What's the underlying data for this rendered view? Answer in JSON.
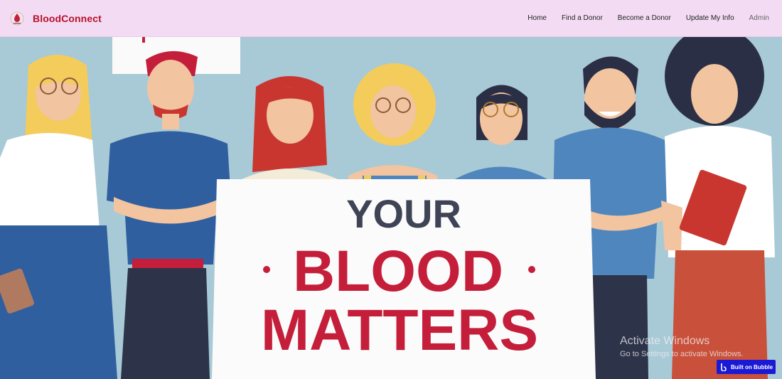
{
  "brand": {
    "name": "BloodConnect",
    "logo_icon": "blood-drop-logo-icon"
  },
  "nav": {
    "items": [
      {
        "label": "Home"
      },
      {
        "label": "Find a Donor"
      },
      {
        "label": "Become a Donor"
      },
      {
        "label": "Update My Info"
      },
      {
        "label": "Admin"
      }
    ]
  },
  "hero": {
    "poster_line1": "YOUR",
    "poster_line2": "BLOOD",
    "poster_line3": "MATTERS",
    "colors": {
      "background": "#a8c9d6",
      "red": "#c41e3a",
      "navy": "#3f4356"
    }
  },
  "watermark": {
    "line1": "Activate Windows",
    "line2": "Go to Settings to activate Windows."
  },
  "badge": {
    "label": "Built on Bubble",
    "icon": "bubble-b-icon"
  }
}
